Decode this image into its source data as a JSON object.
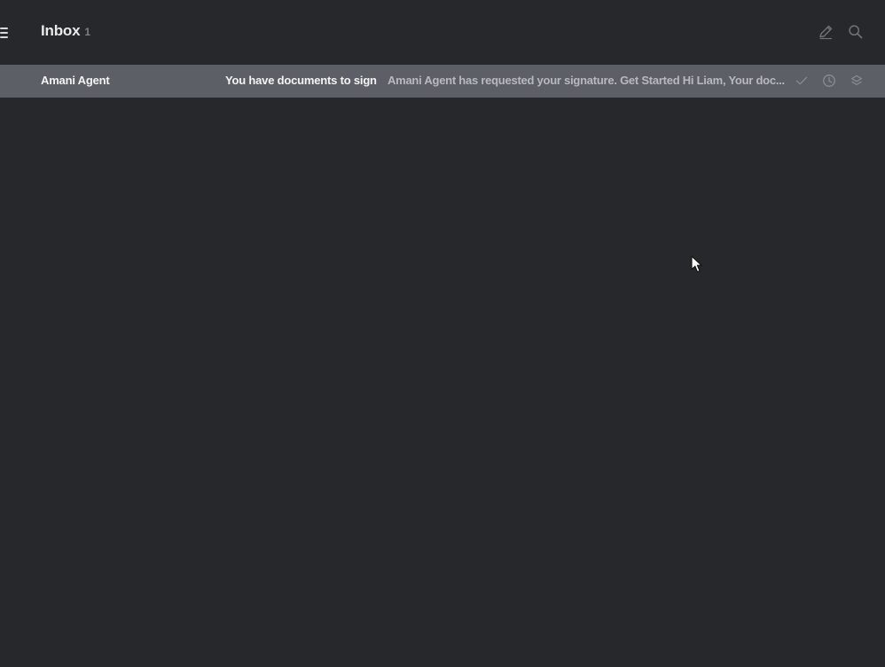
{
  "header": {
    "title": "Inbox",
    "unread_count": "1",
    "icons": {
      "menu": "menu-icon",
      "compose": "compose-icon",
      "search": "search-icon"
    }
  },
  "messages": [
    {
      "sender": "Amani Agent",
      "subject": "You have documents to sign",
      "preview": "Amani Agent has requested your signature. Get Started Hi Liam, Your doc...",
      "actions": [
        "done-icon",
        "snooze-icon",
        "archive-icon"
      ]
    }
  ],
  "colors": {
    "background": "#27282c",
    "selected_row": "#5c5f66",
    "title_text": "#e9e9ea",
    "muted_text": "#7c7e84"
  }
}
